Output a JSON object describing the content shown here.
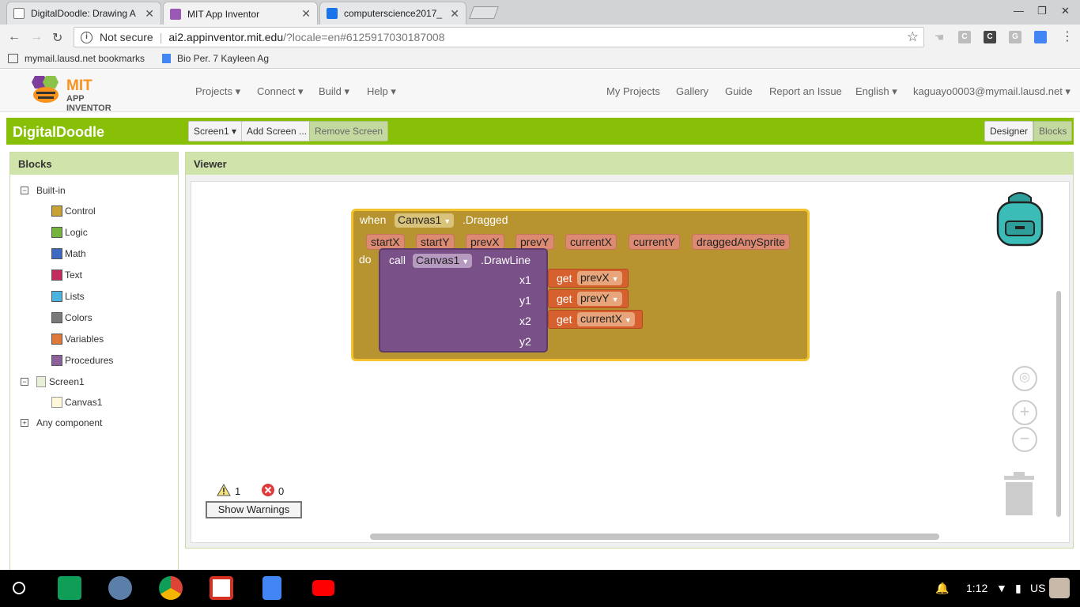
{
  "browser": {
    "tabs": [
      {
        "title": "DigitalDoodle: Drawing A",
        "active": false
      },
      {
        "title": "MIT App Inventor",
        "active": true
      },
      {
        "title": "computerscience2017_",
        "active": false
      }
    ],
    "security_label": "Not secure",
    "url_host": "ai2.appinventor.mit.edu",
    "url_path": "/?locale=en#6125917030187008",
    "extensions": [
      "C",
      "C",
      "G"
    ],
    "bookmarks": [
      "mymail.lausd.net bookmarks",
      "Bio Per. 7 Kayleen Ag"
    ]
  },
  "appinventor": {
    "logo_top": "MIT",
    "logo_bottom": "APP INVENTOR",
    "menus": [
      "Projects ▾",
      "Connect ▾",
      "Build ▾",
      "Help ▾"
    ],
    "right_links": [
      "My Projects",
      "Gallery",
      "Guide",
      "Report an Issue",
      "English ▾",
      "kaguayo0003@mymail.lausd.net ▾"
    ],
    "project_name": "DigitalDoodle",
    "screen_select": "Screen1 ▾",
    "add_screen": "Add Screen ...",
    "remove_screen": "Remove Screen",
    "designer": "Designer",
    "blocks": "Blocks"
  },
  "blocks_panel": {
    "title": "Blocks",
    "builtin_label": "Built-in",
    "builtin_items": [
      {
        "label": "Control",
        "color": "#c9a236"
      },
      {
        "label": "Logic",
        "color": "#73b33e"
      },
      {
        "label": "Math",
        "color": "#3d69c1"
      },
      {
        "label": "Text",
        "color": "#c22c5e"
      },
      {
        "label": "Lists",
        "color": "#4ab3e0"
      },
      {
        "label": "Colors",
        "color": "#7a7a7a"
      },
      {
        "label": "Variables",
        "color": "#e0783a"
      },
      {
        "label": "Procedures",
        "color": "#8d5f9c"
      }
    ],
    "screen_label": "Screen1",
    "canvas_label": "Canvas1",
    "any_component": "Any component"
  },
  "viewer": {
    "title": "Viewer",
    "event_block": {
      "when": "when",
      "component": "Canvas1",
      "event": ".Dragged",
      "params": [
        "startX",
        "startY",
        "prevX",
        "prevY",
        "currentX",
        "currentY",
        "draggedAnySprite"
      ],
      "do": "do"
    },
    "call_block": {
      "call": "call",
      "component": "Canvas1",
      "method": ".DrawLine",
      "args": [
        "x1",
        "y1",
        "x2",
        "y2"
      ]
    },
    "gets": [
      {
        "get": "get",
        "var": "prevX"
      },
      {
        "get": "get",
        "var": "prevY"
      },
      {
        "get": "get",
        "var": "currentX"
      }
    ],
    "warnings_count": "1",
    "errors_count": "0",
    "show_warnings": "Show Warnings"
  },
  "taskbar": {
    "time": "1:12",
    "locale": "US"
  }
}
